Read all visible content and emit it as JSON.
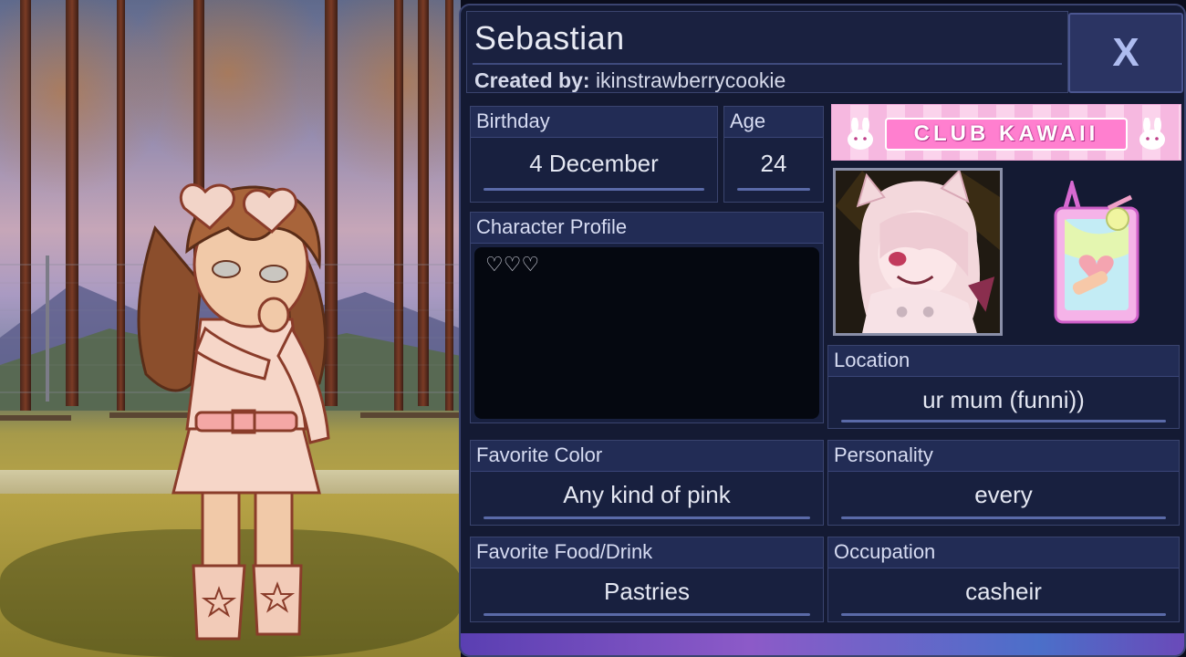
{
  "profile": {
    "name": "Sebastian",
    "created_by_label": "Created by:",
    "creator": "ikinstrawberrycookie",
    "close_label": "X",
    "birthday_label": "Birthday",
    "birthday": "4 December",
    "age_label": "Age",
    "age": "24",
    "character_profile_label": "Character Profile",
    "character_profile": "♡♡♡",
    "location_label": "Location",
    "location": "ur mum (funni))",
    "favorite_color_label": "Favorite Color",
    "favorite_color": "Any kind of pink",
    "personality_label": "Personality",
    "personality": "every",
    "favorite_food_label": "Favorite Food/Drink",
    "favorite_food": "Pastries",
    "occupation_label": "Occupation",
    "occupation": "casheir"
  },
  "banner": {
    "text": "CLUB KAWAII"
  },
  "colors": {
    "panel": "#141a33",
    "field_header": "#222c55",
    "accent_pink": "#ff7fcf",
    "underline": "#5a6aa8"
  },
  "icons": {
    "close": "close-icon",
    "bunny": "bunny-icon",
    "phone": "phone-sticker-icon"
  }
}
